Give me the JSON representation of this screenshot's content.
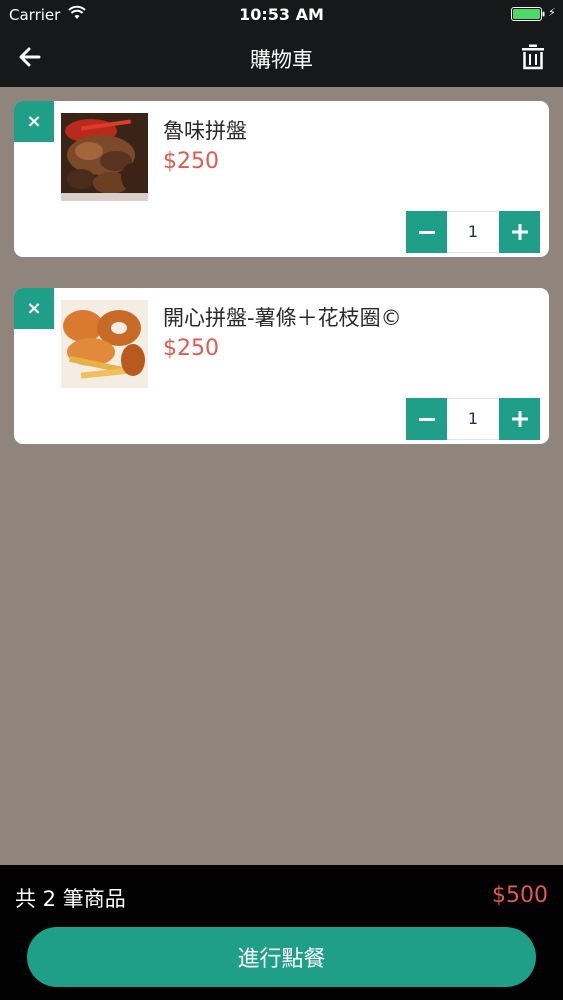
{
  "status_bar": {
    "carrier": "Carrier",
    "time": "10:53 AM"
  },
  "nav": {
    "title": "購物車",
    "back_icon": "arrow-left-icon",
    "trash_icon": "trash-icon"
  },
  "items": [
    {
      "name": "魯味拼盤",
      "price": "$250",
      "quantity": "1",
      "remove_label": "×",
      "image": "braised-meat-platter-photo"
    },
    {
      "name": "開心拼盤-薯條＋花枝圈©",
      "price": "$250",
      "quantity": "1",
      "remove_label": "×",
      "image": "fried-platter-photo"
    }
  ],
  "summary": {
    "count_text": "共 2 筆商品",
    "total": "$500",
    "checkout_label": "進行點餐"
  },
  "colors": {
    "accent": "#1f9e88",
    "price": "#e05a51",
    "background": "#8f857c",
    "bar": "#161819"
  }
}
